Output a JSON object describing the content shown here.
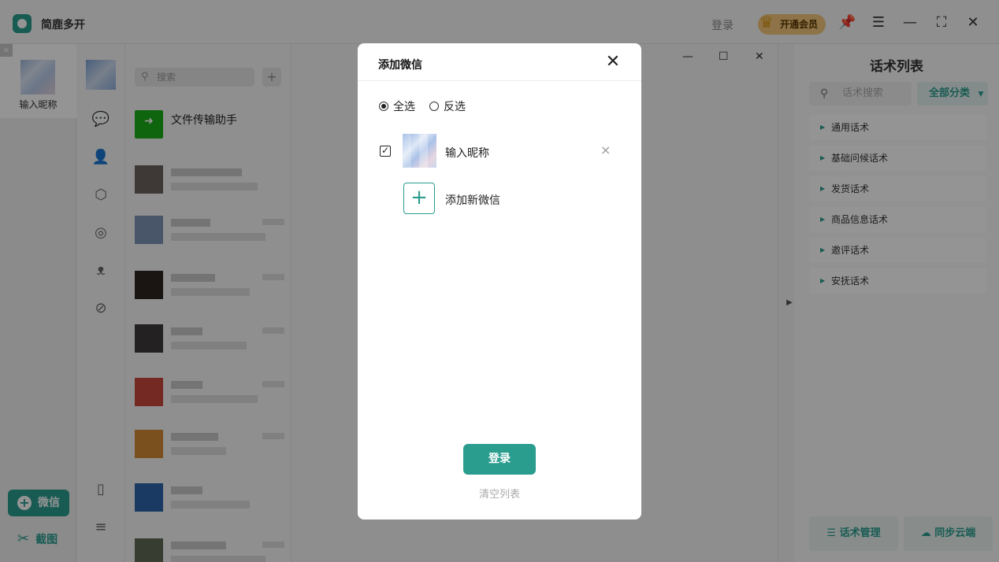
{
  "app": {
    "title": "简鹿多开",
    "login_label": "登录",
    "vip_label": "开通会员",
    "vip_badge": "VIP"
  },
  "accounts": {
    "items": [
      {
        "name": "输入昵称"
      }
    ],
    "add_wechat_label": "微信",
    "screenshot_label": "截图"
  },
  "chat_list": {
    "search_placeholder": "搜索",
    "pinned": {
      "title": "文件传输助手"
    }
  },
  "right_panel": {
    "title": "话术列表",
    "search_placeholder": "话术搜索",
    "category_label": "全部分类",
    "categories": [
      "通用话术",
      "基础问候话术",
      "发货话术",
      "商品信息话术",
      "邀评话术",
      "安抚话术"
    ],
    "manage_label": "话术管理",
    "sync_label": "同步云端"
  },
  "dialog": {
    "title": "添加微信",
    "select_all_label": "全选",
    "invert_label": "反选",
    "accounts": [
      {
        "name": "输入昵称",
        "checked": true
      }
    ],
    "add_new_label": "添加新微信",
    "login_button": "登录",
    "clear_list_link": "清空列表"
  },
  "colors": {
    "accent": "#2a9d8f",
    "wechat_green": "#1aad19",
    "vip_gold": "#f3c77a"
  }
}
